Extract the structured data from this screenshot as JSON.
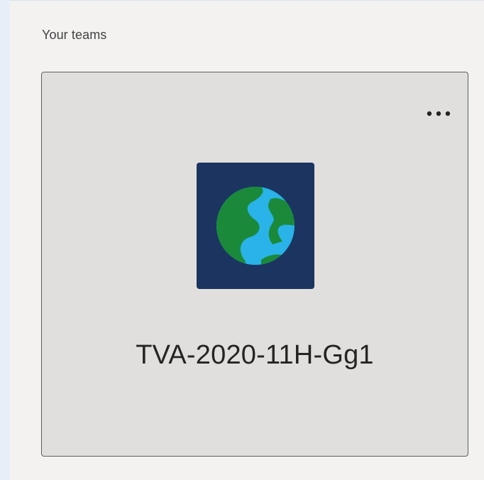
{
  "section": {
    "title": "Your teams"
  },
  "teams": [
    {
      "name": "TVA-2020-11H-Gg1",
      "icon": "globe-icon",
      "more_icon": "more-options-icon"
    }
  ],
  "colors": {
    "page_background": "#e6eef8",
    "panel_background": "#f3f2f1",
    "card_background": "#e1dfdd",
    "card_border": "#5e5e5e",
    "avatar_background": "#1b3560",
    "globe_ocean": "#29b3e8",
    "globe_land": "#1a8a3a"
  }
}
